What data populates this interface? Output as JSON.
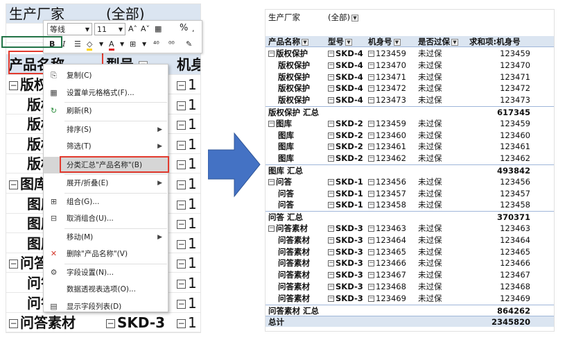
{
  "left": {
    "filter_label": "生产厂家",
    "filter_value": "(全部)",
    "header": {
      "c1": "产品名称",
      "c2": "型号",
      "c3": "机身号"
    },
    "rows": [
      {
        "c1": "版权保护",
        "c2": "",
        "c3": "1",
        "grp": true
      },
      {
        "c1": "版权保护",
        "c2": "",
        "c3": "1"
      },
      {
        "c1": "版权保护",
        "c2": "",
        "c3": "1"
      },
      {
        "c1": "版权保护",
        "c2": "",
        "c3": "1"
      },
      {
        "c1": "版权保护",
        "c2": "",
        "c3": "1"
      },
      {
        "c1": "图库",
        "c2": "",
        "c3": "1",
        "grp": true
      },
      {
        "c1": "图库",
        "c2": "",
        "c3": "1"
      },
      {
        "c1": "图库",
        "c2": "",
        "c3": "1"
      },
      {
        "c1": "图库",
        "c2": "",
        "c3": "1"
      },
      {
        "c1": "问答",
        "c2": "",
        "c3": "1",
        "grp": true
      },
      {
        "c1": "问答",
        "c2": "",
        "c3": "1"
      },
      {
        "c1": "问答",
        "c2": "",
        "c3": "1"
      },
      {
        "c1": "问答素材",
        "c2": "SKD-3",
        "c3": "1",
        "grp": true
      }
    ]
  },
  "mini_toolbar": {
    "font_name": "等线",
    "font_size": "11",
    "grow": "A˄",
    "shrink": "A˅",
    "percent": "%",
    "bold": "B",
    "italic": "I"
  },
  "context_menu": {
    "items": [
      {
        "label": "复制(C)",
        "icon": "copy-icon",
        "glyph": "⎘"
      },
      {
        "label": "设置单元格格式(F)...",
        "icon": "format-cells-icon",
        "glyph": "▦"
      },
      {
        "label": "刷新(R)",
        "icon": "refresh-icon",
        "glyph": "↻"
      },
      {
        "label": "排序(S)",
        "icon": "",
        "glyph": "",
        "submenu": true
      },
      {
        "label": "筛选(T)",
        "icon": "",
        "glyph": "",
        "submenu": true
      },
      {
        "label": "分类汇总\"产品名称\"(B)",
        "icon": "",
        "glyph": "",
        "highlight": true
      },
      {
        "label": "展开/折叠(E)",
        "icon": "",
        "glyph": "",
        "submenu": true
      },
      {
        "label": "组合(G)...",
        "icon": "group-icon",
        "glyph": "⊞"
      },
      {
        "label": "取消组合(U)...",
        "icon": "ungroup-icon",
        "glyph": "⊟"
      },
      {
        "label": "移动(M)",
        "icon": "",
        "glyph": "",
        "submenu": true
      },
      {
        "label": "删除\"产品名称\"(V)",
        "icon": "delete-icon",
        "glyph": "✕"
      },
      {
        "label": "字段设置(N)...",
        "icon": "field-settings-icon",
        "glyph": "⚙"
      },
      {
        "label": "数据透视表选项(O)...",
        "icon": "",
        "glyph": ""
      },
      {
        "label": "显示字段列表(D)",
        "icon": "field-list-icon",
        "glyph": "▤"
      }
    ]
  },
  "right": {
    "filter_label": "生产厂家",
    "filter_value": "(全部)",
    "header": {
      "c1": "产品名称",
      "c2": "型号",
      "c3": "机身号",
      "c4": "是否过保",
      "c5": "求和项:机身号"
    },
    "rows": [
      {
        "type": "data",
        "c1": "版权保护",
        "c2": "SKD-4",
        "c3": "123459",
        "c4": "未过保",
        "c5": "123459",
        "first": true
      },
      {
        "type": "data",
        "c1": "版权保护",
        "c2": "SKD-4",
        "c3": "123470",
        "c4": "未过保",
        "c5": "123470"
      },
      {
        "type": "data",
        "c1": "版权保护",
        "c2": "SKD-4",
        "c3": "123471",
        "c4": "未过保",
        "c5": "123471"
      },
      {
        "type": "data",
        "c1": "版权保护",
        "c2": "SKD-4",
        "c3": "123472",
        "c4": "未过保",
        "c5": "123472"
      },
      {
        "type": "data",
        "c1": "版权保护",
        "c2": "SKD-4",
        "c3": "123473",
        "c4": "未过保",
        "c5": "123473"
      },
      {
        "type": "subtotal",
        "c1": "版权保护 汇总",
        "c5": "617345"
      },
      {
        "type": "data",
        "c1": "图库",
        "c2": "SKD-2",
        "c3": "123459",
        "c4": "未过保",
        "c5": "123459",
        "first": true
      },
      {
        "type": "data",
        "c1": "图库",
        "c2": "SKD-2",
        "c3": "123460",
        "c4": "未过保",
        "c5": "123460"
      },
      {
        "type": "data",
        "c1": "图库",
        "c2": "SKD-2",
        "c3": "123461",
        "c4": "未过保",
        "c5": "123461"
      },
      {
        "type": "data",
        "c1": "图库",
        "c2": "SKD-2",
        "c3": "123462",
        "c4": "未过保",
        "c5": "123462"
      },
      {
        "type": "subtotal",
        "c1": "图库 汇总",
        "c5": "493842"
      },
      {
        "type": "data",
        "c1": "问答",
        "c2": "SKD-1",
        "c3": "123456",
        "c4": "未过保",
        "c5": "123456",
        "first": true
      },
      {
        "type": "data",
        "c1": "问答",
        "c2": "SKD-1",
        "c3": "123457",
        "c4": "未过保",
        "c5": "123457"
      },
      {
        "type": "data",
        "c1": "问答",
        "c2": "SKD-1",
        "c3": "123458",
        "c4": "未过保",
        "c5": "123458"
      },
      {
        "type": "subtotal",
        "c1": "问答 汇总",
        "c5": "370371"
      },
      {
        "type": "data",
        "c1": "问答素材",
        "c2": "SKD-3",
        "c3": "123463",
        "c4": "未过保",
        "c5": "123463",
        "first": true
      },
      {
        "type": "data",
        "c1": "问答素材",
        "c2": "SKD-3",
        "c3": "123464",
        "c4": "未过保",
        "c5": "123464"
      },
      {
        "type": "data",
        "c1": "问答素材",
        "c2": "SKD-3",
        "c3": "123465",
        "c4": "未过保",
        "c5": "123465"
      },
      {
        "type": "data",
        "c1": "问答素材",
        "c2": "SKD-3",
        "c3": "123466",
        "c4": "未过保",
        "c5": "123466"
      },
      {
        "type": "data",
        "c1": "问答素材",
        "c2": "SKD-3",
        "c3": "123467",
        "c4": "未过保",
        "c5": "123467"
      },
      {
        "type": "data",
        "c1": "问答素材",
        "c2": "SKD-3",
        "c3": "123468",
        "c4": "未过保",
        "c5": "123468"
      },
      {
        "type": "data",
        "c1": "问答素材",
        "c2": "SKD-3",
        "c3": "123469",
        "c4": "未过保",
        "c5": "123469"
      },
      {
        "type": "subtotal",
        "c1": "问答素材 汇总",
        "c5": "864262"
      },
      {
        "type": "total",
        "c1": "总计",
        "c5": "2345820"
      }
    ]
  },
  "colors": {
    "highlight_red": "#e23a2e",
    "arrow_blue": "#4472c4",
    "pivot_header": "#dbe5f1",
    "excel_green": "#217346"
  }
}
